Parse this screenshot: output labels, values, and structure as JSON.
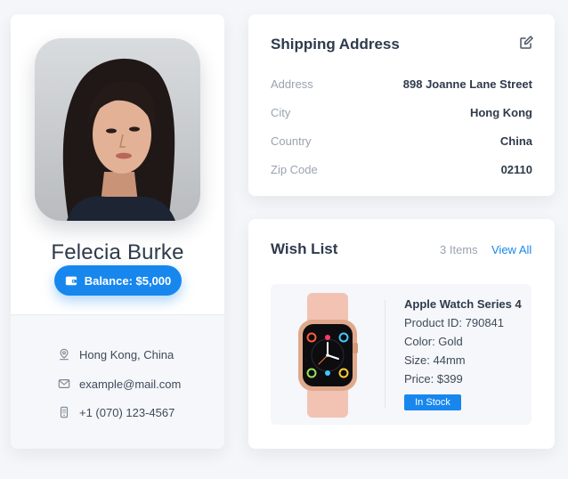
{
  "profile": {
    "name": "Felecia Burke",
    "balance_label": "Balance: $5,000",
    "location": "Hong Kong, China",
    "email": "example@mail.com",
    "phone": "+1 (070) 123-4567",
    "icons": [
      "wallet-icon",
      "location-pin-icon",
      "mail-icon",
      "phone-icon"
    ]
  },
  "shipping": {
    "title": "Shipping Address",
    "edit_icon": "edit-icon",
    "fields": [
      {
        "label": "Address",
        "value": "898 Joanne Lane Street"
      },
      {
        "label": "City",
        "value": "Hong Kong"
      },
      {
        "label": "Country",
        "value": "China"
      },
      {
        "label": "Zip Code",
        "value": "02110"
      }
    ]
  },
  "wishlist": {
    "title": "Wish List",
    "count": "3 Items",
    "view_all": "View All",
    "product": {
      "name": "Apple Watch Series 4",
      "product_id": "Product ID: 790841",
      "color": "Color: Gold",
      "size": "Size: 44mm",
      "price": "Price: $399",
      "stock": "In Stock"
    }
  },
  "colors": {
    "accent": "#1787ee",
    "background": "#f4f6f9",
    "card": "#ffffff",
    "muted_text": "#9aa3b0",
    "strong_text": "#2f3a4b"
  }
}
